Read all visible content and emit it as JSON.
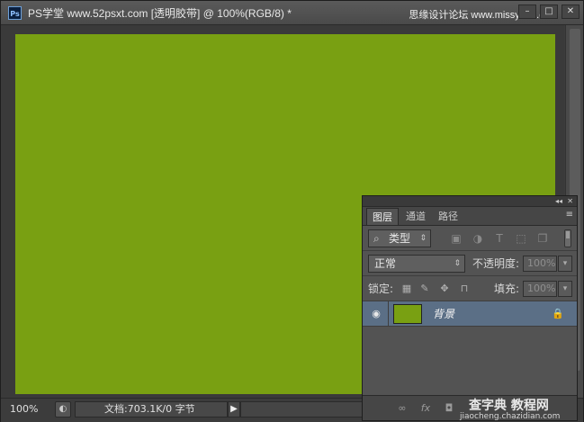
{
  "window": {
    "app_icon": "Ps",
    "title": "PS学堂 www.52psxt.com [透明胶带] @ 100%(RGB/8) *",
    "watermark_top": "思缘设计论坛 www.missyuan.com",
    "buttons": {
      "minimize": "–",
      "maximize": "□",
      "close": "✕"
    }
  },
  "canvas": {
    "fill_color": "#79a012",
    "background_color": "#3a3a3a"
  },
  "status": {
    "zoom": "100%",
    "doc_info": "文档:703.1K/0 字节",
    "arrow": "▶"
  },
  "layers_panel": {
    "collapse": "◂◂",
    "close": "✕",
    "tabs": [
      {
        "label": "图层",
        "active": true
      },
      {
        "label": "通道",
        "active": false
      },
      {
        "label": "路径",
        "active": false
      }
    ],
    "menu_icon": "≡",
    "filter": {
      "search_glyph": "⌕",
      "label": "类型",
      "arrow": "⇕"
    },
    "blend_mode": {
      "value": "正常",
      "arrow": "⇕"
    },
    "opacity": {
      "label": "不透明度:",
      "value": "100%",
      "arrow": "▾"
    },
    "lock": {
      "label": "锁定:"
    },
    "fill": {
      "label": "填充:",
      "value": "100%",
      "arrow": "▾"
    },
    "layers": [
      {
        "name": "背景",
        "thumb_color": "#79a012",
        "visible_glyph": "◉",
        "lock_glyph": "🔒"
      }
    ],
    "footer": {
      "link_glyph": "∞",
      "fx_glyph": "fx",
      "mask_glyph": "◘"
    },
    "watermark": {
      "line1": "查字典 教程网",
      "line2": "jiaocheng.chazidian.com"
    }
  }
}
